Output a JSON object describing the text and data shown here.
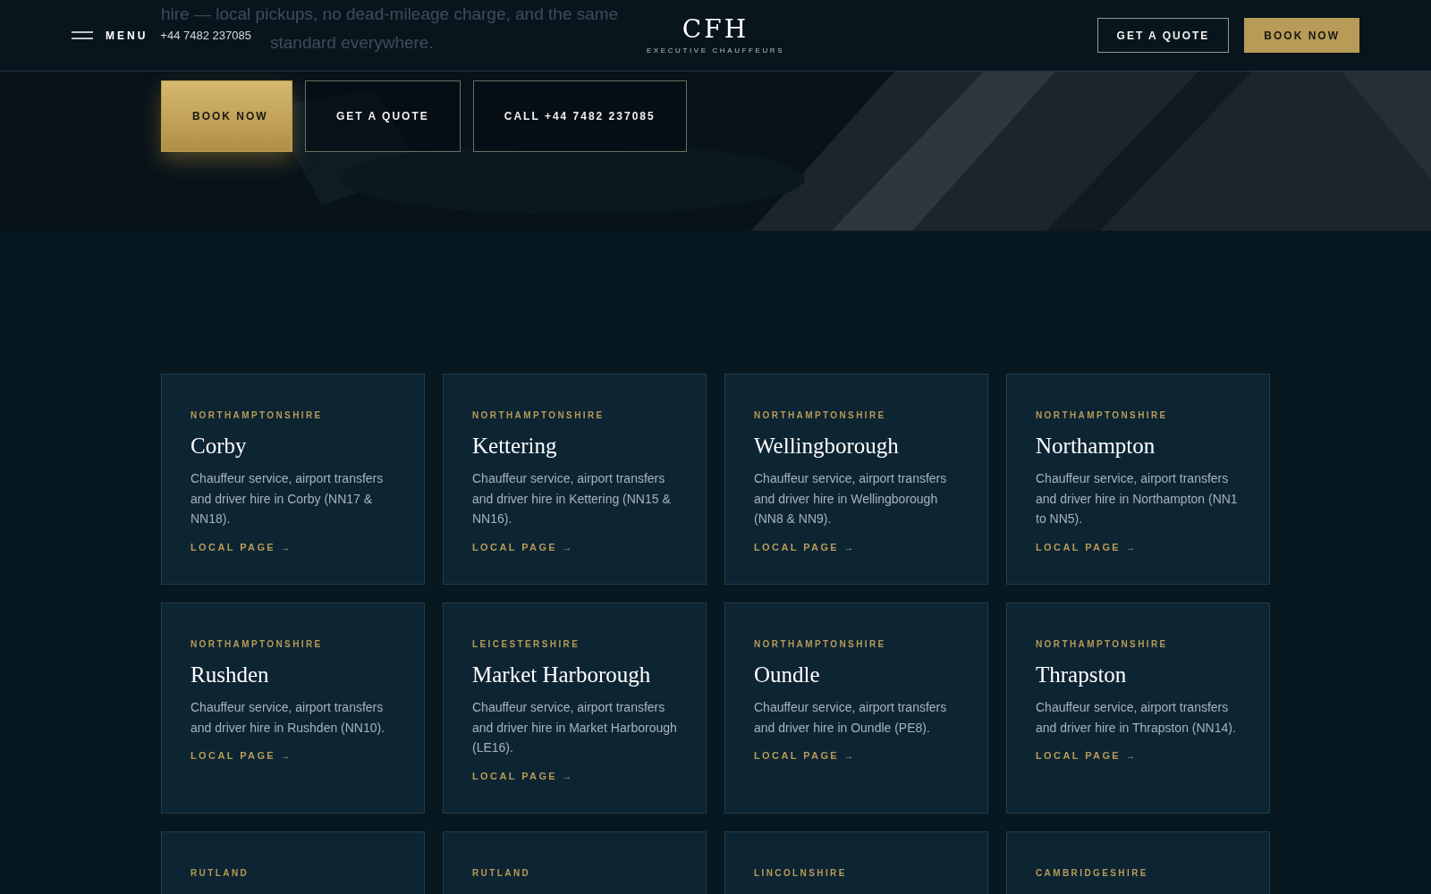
{
  "hero": {
    "kind": "picture",
    "text_lines": [
      "hire — local pickups, no dead-mileage charge, and the same",
      "standard everywhere."
    ],
    "buttons": [
      {
        "label": "BOOK NOW",
        "kind": "primary"
      },
      {
        "label": "GET A QUOTE",
        "kind": "outline"
      },
      {
        "label": "CALL +44 7482 237085",
        "kind": "outline"
      }
    ]
  },
  "header": {
    "menu_label": "MENU",
    "phone": "+44 7482 237085",
    "logo": "CFH",
    "tagline": "EXECUTIVE CHAUFFEURS",
    "buttons": [
      {
        "label": "GET A QUOTE",
        "kind": "outline"
      },
      {
        "label": "BOOK NOW",
        "kind": "primary"
      }
    ]
  },
  "areas": [
    {
      "region": "NORTHAMPTONSHIRE",
      "name": "Corby",
      "description": "Chauffeur service, airport transfers and driver hire in Corby (NN17 & NN18).",
      "link": "LOCAL PAGE →"
    },
    {
      "region": "NORTHAMPTONSHIRE",
      "name": "Kettering",
      "description": "Chauffeur service, airport transfers and driver hire in Kettering (NN15 & NN16).",
      "link": "LOCAL PAGE →"
    },
    {
      "region": "NORTHAMPTONSHIRE",
      "name": "Wellingborough",
      "description": "Chauffeur service, airport transfers and driver hire in Wellingborough (NN8 & NN9).",
      "link": "LOCAL PAGE →"
    },
    {
      "region": "NORTHAMPTONSHIRE",
      "name": "Northampton",
      "description": "Chauffeur service, airport transfers and driver hire in Northampton (NN1 to NN5).",
      "link": "LOCAL PAGE →"
    },
    {
      "region": "NORTHAMPTONSHIRE",
      "name": "Rushden",
      "description": "Chauffeur service, airport transfers and driver hire in Rushden (NN10).",
      "link": "LOCAL PAGE →"
    },
    {
      "region": "LEICESTERSHIRE",
      "name": "Market Harborough",
      "description": "Chauffeur service, airport transfers and driver hire in Market Harborough (LE16).",
      "link": "LOCAL PAGE →"
    },
    {
      "region": "NORTHAMPTONSHIRE",
      "name": "Oundle",
      "description": "Chauffeur service, airport transfers and driver hire in Oundle (PE8).",
      "link": "LOCAL PAGE →"
    },
    {
      "region": "NORTHAMPTONSHIRE",
      "name": "Thrapston",
      "description": "Chauffeur service, airport transfers and driver hire in Thrapston (NN14).",
      "link": "LOCAL PAGE →"
    },
    {
      "region": "RUTLAND"
    },
    {
      "region": "RUTLAND"
    },
    {
      "region": "LINCOLNSHIRE"
    },
    {
      "region": "CAMBRIDGESHIRE"
    }
  ]
}
